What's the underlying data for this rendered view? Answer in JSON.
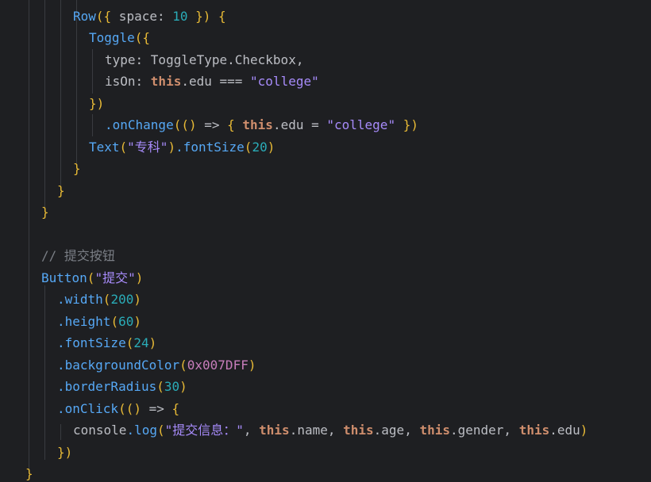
{
  "editor": {
    "lines": [
      {
        "indent": 92,
        "tokens": [
          {
            "t": "Row",
            "c": "tok-component"
          },
          {
            "t": "({",
            "c": "tok-paren"
          },
          {
            "t": " space",
            "c": "tok-field"
          },
          {
            "t": ": ",
            "c": "tok-op"
          },
          {
            "t": "10",
            "c": "tok-number"
          },
          {
            "t": " })",
            "c": "tok-paren"
          },
          {
            "t": " {",
            "c": "tok-brace"
          }
        ]
      },
      {
        "indent": 112,
        "tokens": [
          {
            "t": "Toggle",
            "c": "tok-component"
          },
          {
            "t": "({",
            "c": "tok-paren"
          }
        ]
      },
      {
        "indent": 132,
        "tokens": [
          {
            "t": "type",
            "c": "tok-field"
          },
          {
            "t": ": ToggleType.Checkbox,",
            "c": "tok-op"
          }
        ]
      },
      {
        "indent": 132,
        "tokens": [
          {
            "t": "isOn",
            "c": "tok-field"
          },
          {
            "t": ": ",
            "c": "tok-op"
          },
          {
            "t": "this",
            "c": "tok-this"
          },
          {
            "t": ".edu === ",
            "c": "tok-op"
          },
          {
            "t": "\"college\"",
            "c": "tok-lav"
          }
        ]
      },
      {
        "indent": 112,
        "tokens": [
          {
            "t": "})",
            "c": "tok-paren"
          }
        ]
      },
      {
        "indent": 132,
        "tokens": [
          {
            "t": ".onChange",
            "c": "tok-method"
          },
          {
            "t": "(() ",
            "c": "tok-paren"
          },
          {
            "t": "=> ",
            "c": "tok-op"
          },
          {
            "t": "{ ",
            "c": "tok-brace"
          },
          {
            "t": "this",
            "c": "tok-this"
          },
          {
            "t": ".edu = ",
            "c": "tok-op"
          },
          {
            "t": "\"college\"",
            "c": "tok-lav"
          },
          {
            "t": " })",
            "c": "tok-brace"
          }
        ]
      },
      {
        "indent": 112,
        "tokens": [
          {
            "t": "Text",
            "c": "tok-component"
          },
          {
            "t": "(",
            "c": "tok-paren"
          },
          {
            "t": "\"专科\"",
            "c": "tok-lav"
          },
          {
            "t": ")",
            "c": "tok-paren"
          },
          {
            "t": ".fontSize",
            "c": "tok-method"
          },
          {
            "t": "(",
            "c": "tok-paren"
          },
          {
            "t": "20",
            "c": "tok-number"
          },
          {
            "t": ")",
            "c": "tok-paren"
          }
        ]
      },
      {
        "indent": 92,
        "tokens": [
          {
            "t": "}",
            "c": "tok-brace"
          }
        ]
      },
      {
        "indent": 72,
        "tokens": [
          {
            "t": "}",
            "c": "tok-brace"
          }
        ]
      },
      {
        "indent": 52,
        "tokens": [
          {
            "t": "}",
            "c": "tok-brace"
          }
        ]
      },
      {
        "indent": 52,
        "tokens": []
      },
      {
        "indent": 52,
        "tokens": [
          {
            "t": "// 提交按钮",
            "c": "tok-comment"
          }
        ]
      },
      {
        "indent": 52,
        "tokens": [
          {
            "t": "Button",
            "c": "tok-component"
          },
          {
            "t": "(",
            "c": "tok-paren"
          },
          {
            "t": "\"提交\"",
            "c": "tok-lav"
          },
          {
            "t": ")",
            "c": "tok-paren"
          }
        ]
      },
      {
        "indent": 72,
        "tokens": [
          {
            "t": ".width",
            "c": "tok-method"
          },
          {
            "t": "(",
            "c": "tok-paren"
          },
          {
            "t": "200",
            "c": "tok-number"
          },
          {
            "t": ")",
            "c": "tok-paren"
          }
        ]
      },
      {
        "indent": 72,
        "tokens": [
          {
            "t": ".height",
            "c": "tok-method"
          },
          {
            "t": "(",
            "c": "tok-paren"
          },
          {
            "t": "60",
            "c": "tok-number"
          },
          {
            "t": ")",
            "c": "tok-paren"
          }
        ]
      },
      {
        "indent": 72,
        "tokens": [
          {
            "t": ".fontSize",
            "c": "tok-method"
          },
          {
            "t": "(",
            "c": "tok-paren"
          },
          {
            "t": "24",
            "c": "tok-number"
          },
          {
            "t": ")",
            "c": "tok-paren"
          }
        ]
      },
      {
        "indent": 72,
        "tokens": [
          {
            "t": ".backgroundColor",
            "c": "tok-method"
          },
          {
            "t": "(",
            "c": "tok-paren"
          },
          {
            "t": "0x007DFF",
            "c": "tok-str2"
          },
          {
            "t": ")",
            "c": "tok-paren"
          }
        ]
      },
      {
        "indent": 72,
        "tokens": [
          {
            "t": ".borderRadius",
            "c": "tok-method"
          },
          {
            "t": "(",
            "c": "tok-paren"
          },
          {
            "t": "30",
            "c": "tok-number"
          },
          {
            "t": ")",
            "c": "tok-paren"
          }
        ]
      },
      {
        "indent": 72,
        "tokens": [
          {
            "t": ".onClick",
            "c": "tok-method"
          },
          {
            "t": "(() ",
            "c": "tok-paren"
          },
          {
            "t": "=> ",
            "c": "tok-op"
          },
          {
            "t": "{",
            "c": "tok-brace"
          }
        ]
      },
      {
        "indent": 92,
        "tokens": [
          {
            "t": "console",
            "c": "tok-field"
          },
          {
            "t": ".log",
            "c": "tok-method"
          },
          {
            "t": "(",
            "c": "tok-paren"
          },
          {
            "t": "\"提交信息：\"",
            "c": "tok-lav"
          },
          {
            "t": ", ",
            "c": "tok-op"
          },
          {
            "t": "this",
            "c": "tok-this"
          },
          {
            "t": ".name, ",
            "c": "tok-op"
          },
          {
            "t": "this",
            "c": "tok-this"
          },
          {
            "t": ".age, ",
            "c": "tok-op"
          },
          {
            "t": "this",
            "c": "tok-this"
          },
          {
            "t": ".gender, ",
            "c": "tok-op"
          },
          {
            "t": "this",
            "c": "tok-this"
          },
          {
            "t": ".edu",
            "c": "tok-op"
          },
          {
            "t": ")",
            "c": "tok-paren"
          }
        ]
      },
      {
        "indent": 72,
        "tokens": [
          {
            "t": "})",
            "c": "tok-brace"
          }
        ]
      },
      {
        "indent": 32,
        "tokens": [
          {
            "t": "}",
            "c": "tok-brace"
          }
        ]
      }
    ]
  }
}
